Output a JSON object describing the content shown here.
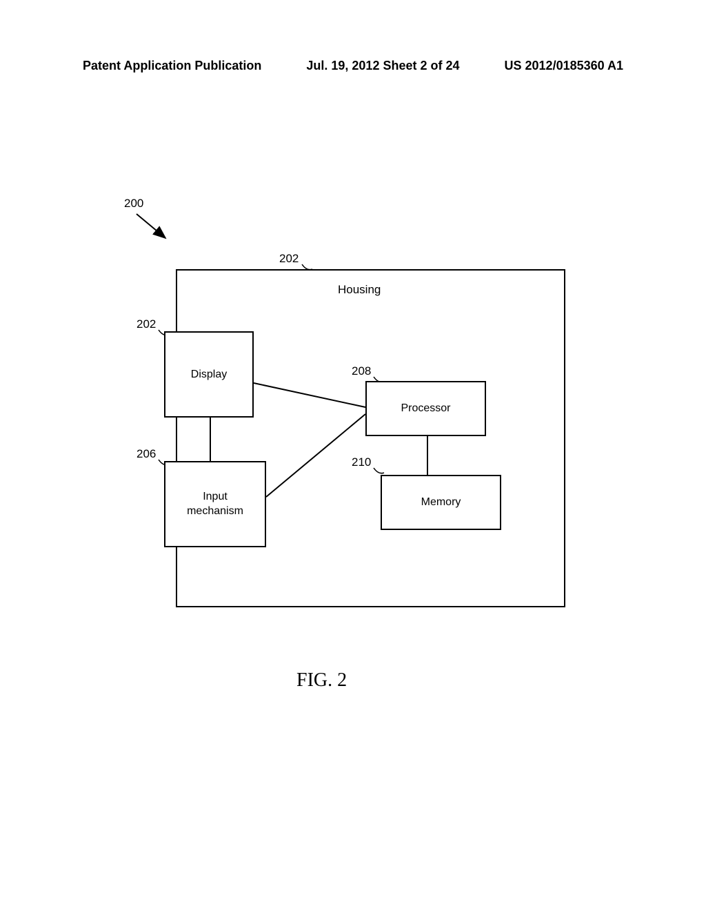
{
  "header": {
    "left": "Patent Application Publication",
    "center": "Jul. 19, 2012  Sheet 2 of 24",
    "right": "US 2012/0185360 A1"
  },
  "refs": {
    "r200": "200",
    "r202top": "202",
    "r202left": "202",
    "r206": "206",
    "r208": "208",
    "r210": "210"
  },
  "boxes": {
    "housing": "Housing",
    "display": "Display",
    "input": "Input\nmechanism",
    "processor": "Processor",
    "memory": "Memory"
  },
  "figure_label": "FIG.  2"
}
